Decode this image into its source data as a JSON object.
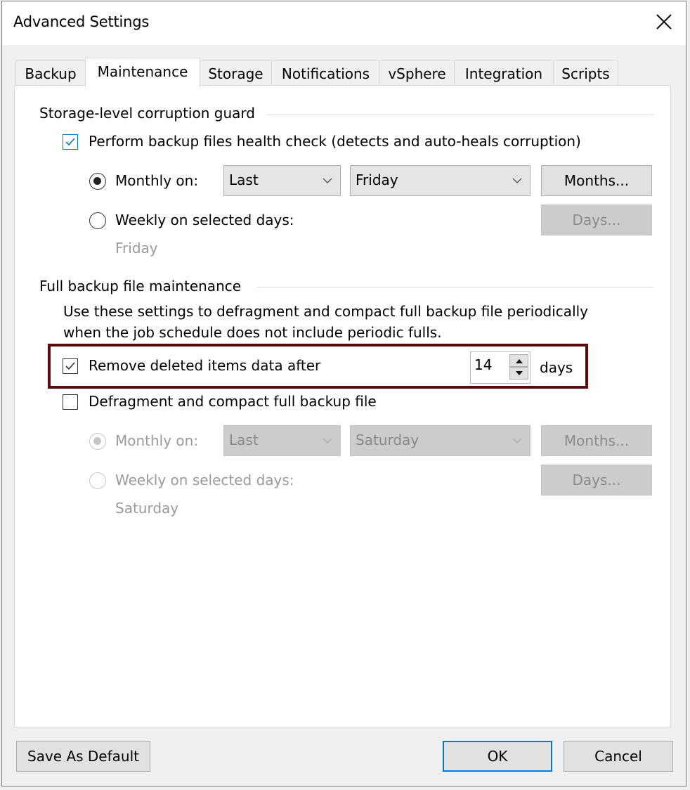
{
  "window": {
    "title": "Advanced Settings",
    "close_icon": "close-icon"
  },
  "tabs": [
    {
      "label": "Backup",
      "active": false
    },
    {
      "label": "Maintenance",
      "active": true
    },
    {
      "label": "Storage",
      "active": false
    },
    {
      "label": "Notifications",
      "active": false
    },
    {
      "label": "vSphere",
      "active": false
    },
    {
      "label": "Integration",
      "active": false
    },
    {
      "label": "Scripts",
      "active": false
    }
  ],
  "corruption_guard": {
    "title": "Storage-level corruption guard",
    "health_check": {
      "label": "Perform backup files health check (detects and auto-heals corruption)",
      "checked": true
    },
    "monthly": {
      "label": "Monthly on:",
      "selected": true,
      "week_value": "Last",
      "day_value": "Friday",
      "months_button": "Months..."
    },
    "weekly": {
      "label": "Weekly on selected days:",
      "selected": false,
      "days_button": "Days...",
      "days_summary": "Friday"
    }
  },
  "full_backup_maintenance": {
    "title": "Full backup file maintenance",
    "description_line1": "Use these settings to defragment and compact full backup file periodically",
    "description_line2": "when the job schedule does not include periodic fulls.",
    "remove_deleted": {
      "label": "Remove deleted items data after",
      "checked": true,
      "value": "14",
      "unit": "days"
    },
    "defragment": {
      "label": "Defragment and compact full backup file",
      "checked": false
    },
    "monthly": {
      "label": "Monthly on:",
      "selected": true,
      "enabled": false,
      "week_value": "Last",
      "day_value": "Saturday",
      "months_button": "Months..."
    },
    "weekly": {
      "label": "Weekly on selected days:",
      "selected": false,
      "enabled": false,
      "days_button": "Days...",
      "days_summary": "Saturday"
    }
  },
  "footer": {
    "save_default": "Save As Default",
    "ok": "OK",
    "cancel": "Cancel"
  },
  "colors": {
    "accent": "#0078d7",
    "highlight_box": "#5c0a0a",
    "disabled_text": "#9a9a9a"
  }
}
